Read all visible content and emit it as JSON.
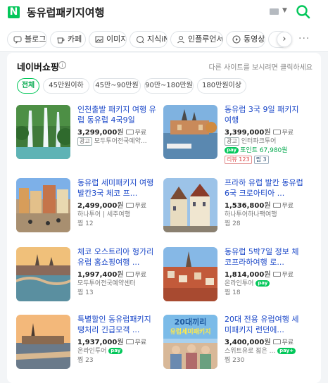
{
  "header": {
    "logo": "N",
    "query": "동유럽패키지여행"
  },
  "tabs": [
    {
      "label": "블로그",
      "icon": "blog-icon"
    },
    {
      "label": "카페",
      "icon": "cafe-icon"
    },
    {
      "label": "이미지",
      "icon": "image-icon"
    },
    {
      "label": "지식iN",
      "icon": "qna-icon"
    },
    {
      "label": "인플루언서",
      "icon": "influencer-icon"
    },
    {
      "label": "동영상",
      "icon": "video-icon"
    }
  ],
  "shopping": {
    "title": "네이버쇼핑",
    "info": "i",
    "other_site": "다른 사이트를 보시려면 클릭하세요",
    "filters": [
      "전체",
      "45만원이하",
      "45만~90만원",
      "90만~180만원",
      "180만원이상"
    ],
    "items": [
      {
        "title": "인천출발 패키지 여행 유럽 동유럽 4국9일",
        "price": "3,299,000",
        "won": "원",
        "ship": "무료",
        "ad": "광고",
        "seller": "모두투어전국예약...",
        "pay": "",
        "point": "",
        "review": "",
        "zzim": ""
      },
      {
        "title": "동유럽 3국 9일 패키지 여행",
        "price": "3,399,000",
        "won": "원",
        "ship": "무료",
        "ad": "광고",
        "seller": "인터파크투어",
        "pay": "pay",
        "point": "포인트 67,980원",
        "review": "리뷰 123",
        "zzim": "찜 3"
      },
      {
        "title": "동유럽 세미패키지 여행 발칸3국 체코 프...",
        "price": "2,499,000",
        "won": "원",
        "ship": "무료",
        "ad": "",
        "seller": "하나투어 | 세주여행",
        "pay": "",
        "point": "",
        "review": "",
        "zzim": "찜 12"
      },
      {
        "title": "프라하 유럽 발칸 동유럽 6국 크로아티아 ...",
        "price": "1,536,800",
        "won": "원",
        "ship": "무료",
        "ad": "",
        "seller": "하나투어하나팩여행",
        "pay": "",
        "point": "",
        "review": "",
        "zzim": "찜 28"
      },
      {
        "title": "체코 오스트리아 헝가리 유럽 홈쇼핑여행 ...",
        "price": "1,997,400",
        "won": "원",
        "ship": "무료",
        "ad": "",
        "seller": "모두투어전국예약센터",
        "pay": "",
        "point": "",
        "review": "",
        "zzim": "찜 13"
      },
      {
        "title": "동유럽 5박7일 정보 체코프라하여행 로...",
        "price": "1,814,000",
        "won": "원",
        "ship": "무료",
        "ad": "",
        "seller": "온라인투어",
        "pay": "pay",
        "point": "",
        "review": "",
        "zzim": "찜 18"
      },
      {
        "title": "특별할인 동유럽패키지 땡처리 긴급모객 ...",
        "price": "1,937,000",
        "won": "원",
        "ship": "무료",
        "ad": "",
        "seller": "온라인투어",
        "pay": "pay",
        "point": "",
        "review": "",
        "zzim": "찜 23"
      },
      {
        "title": "20대 전용 유럽여행 세미패키지 런던에...",
        "price": "3,400,000",
        "won": "원",
        "ship": "무료",
        "ad": "",
        "seller": "스위트유로 젊은 ...",
        "pay": "pay+",
        "point": "",
        "review": "",
        "zzim": "찜 230",
        "thumb_text_1": "20대끼리",
        "thumb_text_2": "유럽세미패키지"
      }
    ]
  },
  "colors": {
    "brand": "#03c75a",
    "link": "#1a47c8"
  }
}
